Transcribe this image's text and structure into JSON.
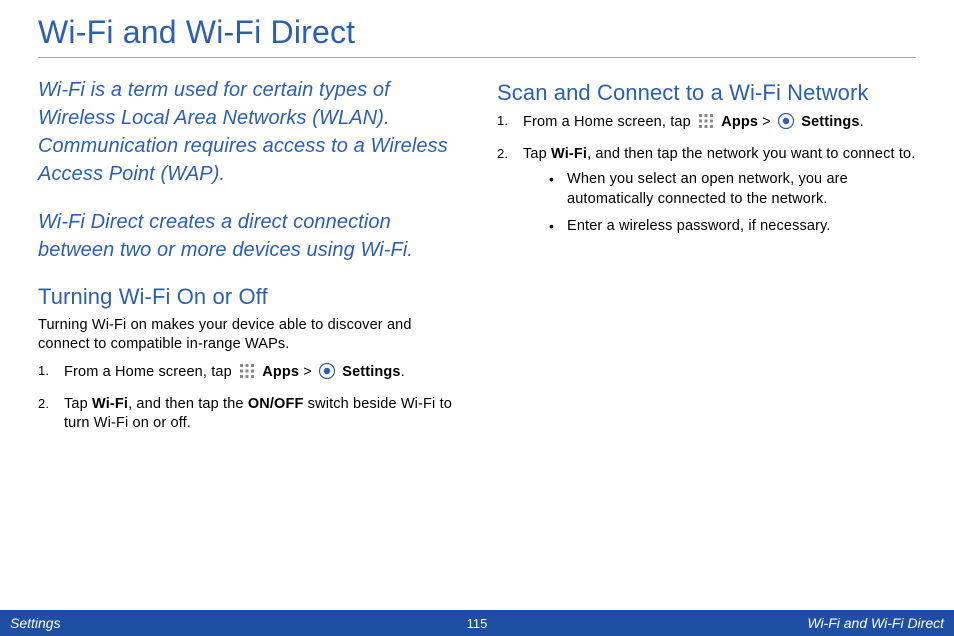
{
  "title": "Wi-Fi and Wi-Fi Direct",
  "intro": {
    "p1": "Wi-Fi is a term used for certain types of Wireless Local Area Networks (WLAN). Communication requires access to a Wireless Access Point (WAP).",
    "p2": "Wi-Fi Direct creates a direct connection between two or more devices using Wi-Fi."
  },
  "left": {
    "heading": "Turning Wi-Fi On or Off",
    "desc": "Turning Wi-Fi on makes your device able to discover and connect to compatible in-range WAPs.",
    "step1_a": "From a Home screen, tap ",
    "step1_apps": "Apps",
    "step1_gt": " > ",
    "step1_settings": "Settings",
    "step1_end": ".",
    "step2_a": "Tap ",
    "step2_wifi": "Wi-Fi",
    "step2_b": ", and then tap the ",
    "step2_switch": "ON/OFF",
    "step2_c": " switch beside Wi-Fi to turn Wi-Fi on or off."
  },
  "right": {
    "heading": "Scan and Connect to a Wi-Fi Network",
    "step1_a": "From a Home screen, tap ",
    "step1_apps": "Apps",
    "step1_gt": " > ",
    "step1_settings": "Settings",
    "step1_end": ".",
    "step2_a": "Tap ",
    "step2_wifi": "Wi-Fi",
    "step2_b": ", and then tap the network you want to connect to.",
    "bullet1": "When you select an open network, you are automatically connected to the network.",
    "bullet2": "Enter a wireless password, if necessary."
  },
  "footer": {
    "left": "Settings",
    "page": "115",
    "right": "Wi-Fi and Wi-Fi Direct"
  }
}
